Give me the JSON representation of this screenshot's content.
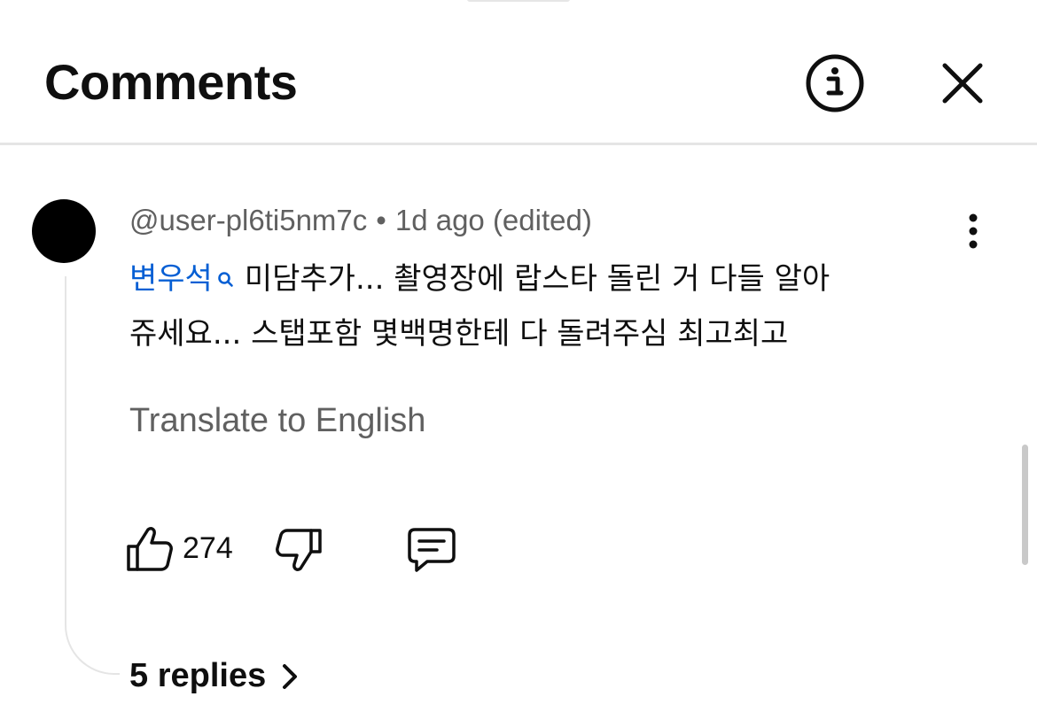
{
  "panel": {
    "title": "Comments"
  },
  "comment": {
    "author": "@user-pl6ti5nm7c",
    "separator": "•",
    "time": "1d ago (edited)",
    "mention": "변우석",
    "text_line1": "미담추가... 촬영장에 랍스타 돌린 거 다들 알아",
    "text_line2": "쥬세요... 스탭포함 몇백명한테 다 돌려주심 최고최고",
    "translate_label": "Translate to English",
    "like_count": "274",
    "replies_label": "5 replies"
  },
  "icons": {
    "info": "info-circle-icon",
    "close": "close-icon",
    "more": "more-vertical-icon",
    "mention_search": "search-icon",
    "like": "thumbs-up-icon",
    "dislike": "thumbs-down-icon",
    "reply": "comment-icon",
    "chevron": "chevron-right-icon"
  },
  "colors": {
    "text": "#0f0f0f",
    "secondary_text": "#606060",
    "link": "#065fd4",
    "divider": "#e5e5e5"
  }
}
